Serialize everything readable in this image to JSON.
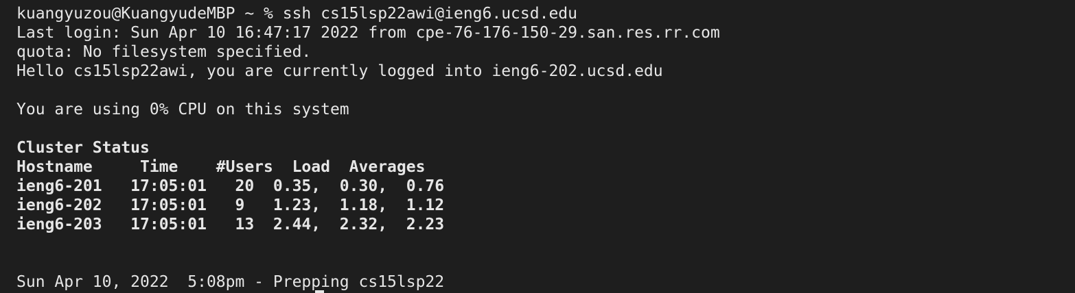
{
  "terminal": {
    "lines": [
      "kuangyuzou@KuangyudeMBP ~ % ssh cs15lsp22awi@ieng6.ucsd.edu",
      "Last login: Sun Apr 10 16:47:17 2022 from cpe-76-176-150-29.san.res.rr.com",
      "quota: No filesystem specified.",
      "Hello cs15lsp22awi, you are currently logged into ieng6-202.ucsd.edu",
      "You are using 0% CPU on this system",
      "Cluster Status",
      "Hostname     Time    #Users  Load  Averages",
      "ieng6-201   17:05:01   20  0.35,  0.30,  0.76",
      "ieng6-202   17:05:01   9   1.23,  1.18,  1.12",
      "ieng6-203   17:05:01   13  2.44,  2.32,  2.23",
      "Sun Apr 10, 2022  5:08pm - Prepping cs15lsp22"
    ]
  },
  "colors": {
    "background": "#1e1e1e",
    "foreground": "#e6e6e6"
  }
}
